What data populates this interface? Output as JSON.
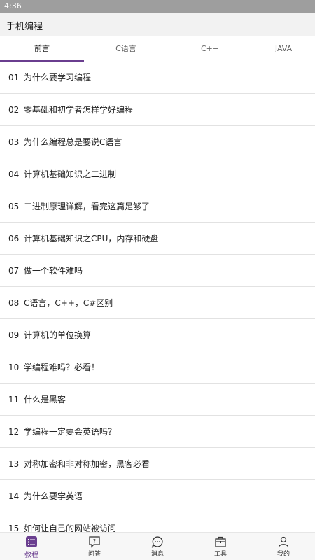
{
  "status_bar": {
    "time": "4:36"
  },
  "app": {
    "title": "手机编程"
  },
  "tabs": [
    {
      "label": "前言",
      "active": true
    },
    {
      "label": "C语言",
      "active": false
    },
    {
      "label": "C++",
      "active": false
    },
    {
      "label": "JAVA",
      "active": false
    }
  ],
  "articles": [
    {
      "num": "01",
      "title": "为什么要学习编程"
    },
    {
      "num": "02",
      "title": "零基础和初学者怎样学好编程"
    },
    {
      "num": "03",
      "title": "为什么编程总是要说C语言"
    },
    {
      "num": "04",
      "title": "计算机基础知识之二进制"
    },
    {
      "num": "05",
      "title": "二进制原理详解，看完这篇足够了"
    },
    {
      "num": "06",
      "title": "计算机基础知识之CPU，内存和硬盘"
    },
    {
      "num": "07",
      "title": "做一个软件难吗"
    },
    {
      "num": "08",
      "title": "C语言，C++，C#区别"
    },
    {
      "num": "09",
      "title": "计算机的单位换算"
    },
    {
      "num": "10",
      "title": "学编程难吗？必看！"
    },
    {
      "num": "11",
      "title": "什么是黑客"
    },
    {
      "num": "12",
      "title": "学编程一定要会英语吗？"
    },
    {
      "num": "13",
      "title": "对称加密和非对称加密，黑客必看"
    },
    {
      "num": "14",
      "title": "为什么要学英语"
    },
    {
      "num": "15",
      "title": "如何让自己的网站被访问"
    }
  ],
  "bottom_nav": [
    {
      "label": "教程",
      "icon": "list-icon",
      "active": true
    },
    {
      "label": "问答",
      "icon": "question-icon",
      "active": false
    },
    {
      "label": "消息",
      "icon": "chat-icon",
      "active": false
    },
    {
      "label": "工具",
      "icon": "toolbox-icon",
      "active": false
    },
    {
      "label": "我的",
      "icon": "person-icon",
      "active": false
    }
  ],
  "colors": {
    "accent": "#6a3e8f",
    "status_bar": "#9e9e9e",
    "app_bar": "#f2f2f2"
  }
}
